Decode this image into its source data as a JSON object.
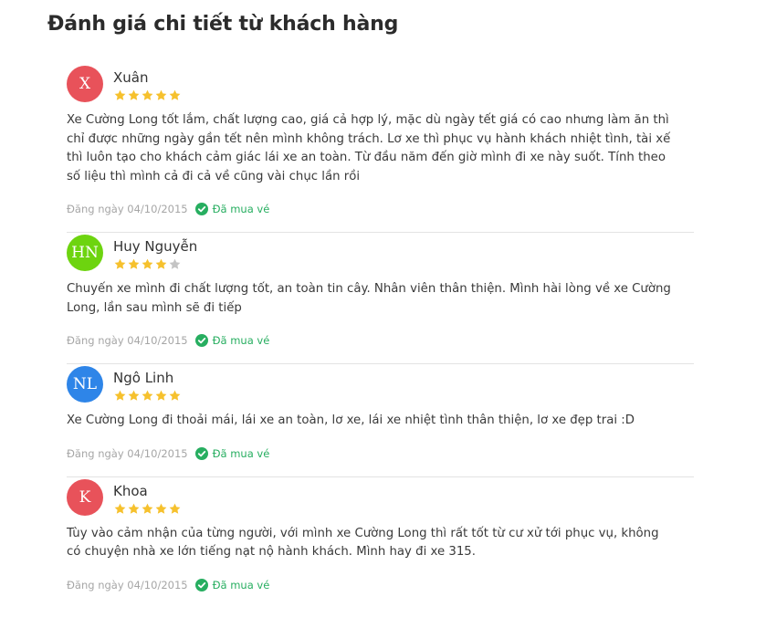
{
  "page_title": "Đánh giá chi tiết từ khách hàng",
  "colors": {
    "star_filled": "#f6c12d",
    "star_empty": "#c4c4c4",
    "verified": "#27ae60"
  },
  "reviews": [
    {
      "initials": "X",
      "avatar_color": "#e8525a",
      "name": "Xuân",
      "rating": 5,
      "text": "Xe Cường Long tốt lắm, chất lượng cao, giá cả hợp lý, mặc dù ngày tết giá có cao nhưng làm ăn thì chỉ được những ngày gần tết nên mình không trách. Lơ xe thì phục vụ hành khách nhiệt tình, tài xế thì luôn tạo cho khách cảm giác lái xe an toàn. Từ đầu năm đến giờ mình đi xe này suốt. Tính theo số liệu thì mình cả đi cả về cũng vài chục lần rồi",
      "date": "Đăng ngày 04/10/2015",
      "verified_label": "Đã mua vé"
    },
    {
      "initials": "HN",
      "avatar_color": "#6dd40f",
      "name": "Huy Nguyễn",
      "rating": 4,
      "text": "Chuyến xe mình đi chất lượng tốt, an toàn tin cây. Nhân viên thân thiện. Mình hài lòng về xe Cường Long, lần sau mình sẽ đi tiếp",
      "date": "Đăng ngày 04/10/2015",
      "verified_label": "Đã mua vé"
    },
    {
      "initials": "NL",
      "avatar_color": "#2e85e8",
      "name": "Ngô Linh",
      "rating": 5,
      "text": "Xe Cường Long đi thoải mái, lái xe an toàn, lơ xe, lái xe nhiệt tình thân thiện, lơ xe đẹp trai :D",
      "date": "Đăng ngày 04/10/2015",
      "verified_label": "Đã mua vé"
    },
    {
      "initials": "K",
      "avatar_color": "#e8525a",
      "name": "Khoa",
      "rating": 5,
      "text": "Tùy vào cảm nhận của từng người, với mình xe Cường Long thì rất tốt từ cư xử tới phục vụ, không có chuyện nhà xe lớn tiếng nạt nộ hành khách. Mình hay đi xe 315.",
      "date": "Đăng ngày 04/10/2015",
      "verified_label": "Đã mua vé"
    }
  ]
}
